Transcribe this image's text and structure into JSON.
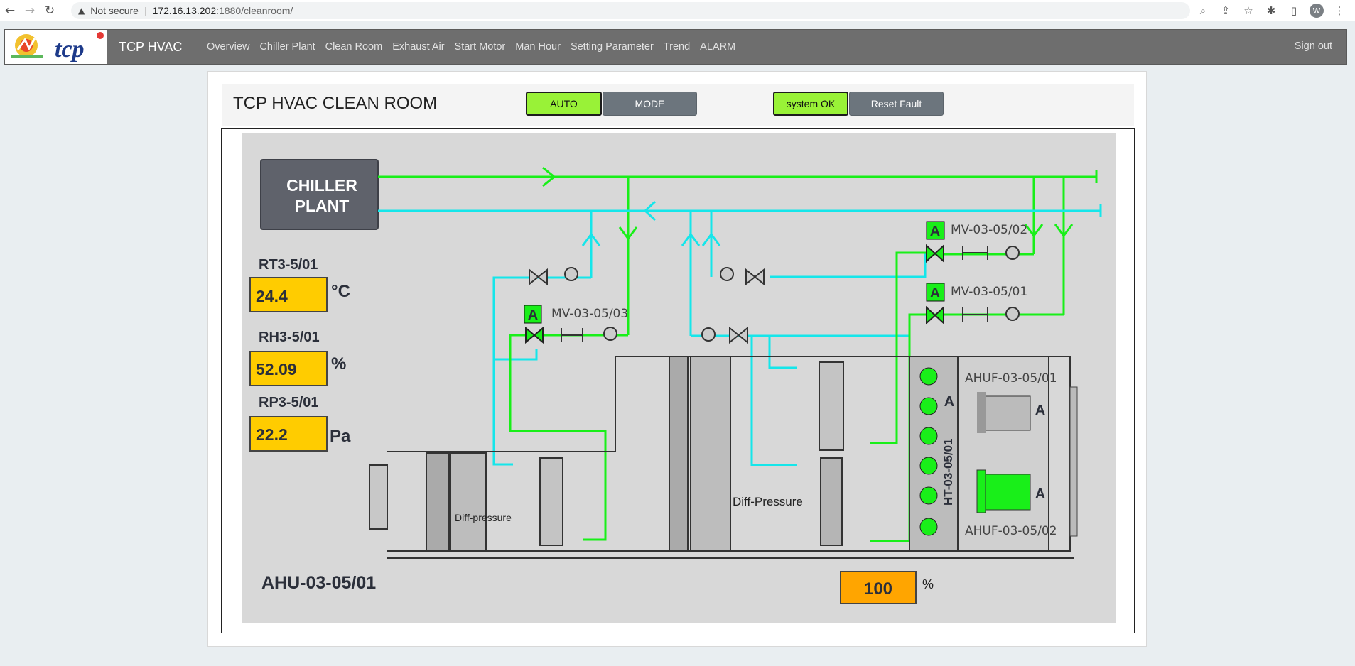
{
  "browser": {
    "security_label": "Not secure",
    "url_host": "172.16.13.202",
    "url_path": ":1880/cleanroom/",
    "profile_initial": "W"
  },
  "header": {
    "brand": "TCP HVAC",
    "logo_text": "tcp",
    "nav": [
      "Overview",
      "Chiller Plant",
      "Clean Room",
      "Exhaust Air",
      "Start Motor",
      "Man Hour",
      "Setting Parameter",
      "Trend",
      "ALARM"
    ],
    "sign_out": "Sign out"
  },
  "page": {
    "title": "TCP HVAC CLEAN ROOM",
    "auto_label": "AUTO",
    "mode_label": "MODE",
    "status_label": "system OK",
    "reset_label": "Reset Fault"
  },
  "diagram": {
    "chiller_line1": "CHILLER",
    "chiller_line2": "PLANT",
    "sensors": [
      {
        "tag": "RT3-5/01",
        "value": "24.4",
        "unit": "°C"
      },
      {
        "tag": "RH3-5/01",
        "value": "52.09",
        "unit": "%"
      },
      {
        "tag": "RP3-5/01",
        "value": "22.2",
        "unit": "Pa"
      }
    ],
    "valves": [
      {
        "tag": "MV-03-05/03",
        "mode": "A"
      },
      {
        "tag": "MV-03-05/02",
        "mode": "A"
      },
      {
        "tag": "MV-03-05/01",
        "mode": "A"
      }
    ],
    "diff_pressure_1": "Diff-pressure",
    "diff_pressure_2": "Diff-Pressure",
    "heater_tag": "HT-03-05/01",
    "heater_mode": "A",
    "fans": [
      {
        "tag": "AHUF-03-05/01",
        "mode": "A"
      },
      {
        "tag": "AHUF-03-05/02",
        "mode": "A"
      }
    ],
    "ahu_tag": "AHU-03-05/01",
    "output_value": "100",
    "output_unit": "%"
  },
  "colors": {
    "supply_pipe": "#19ef19",
    "return_pipe": "#15e6ea",
    "sensor_box": "#ffcc00",
    "output_box": "#ffa500",
    "active_button": "#99f237"
  }
}
